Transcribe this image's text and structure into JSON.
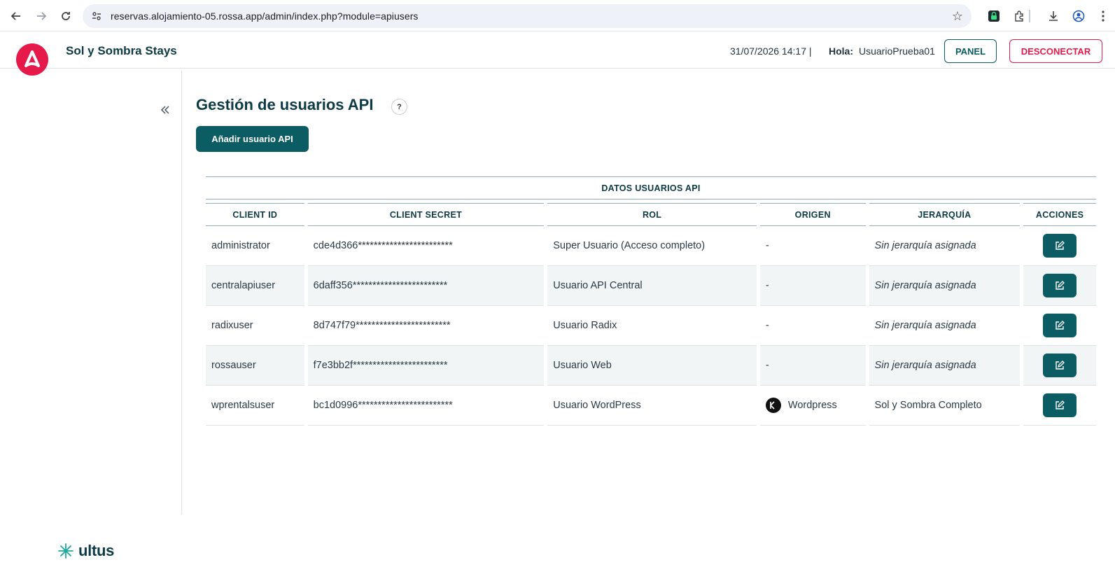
{
  "browser": {
    "url": "reservas.alojamiento-05.rossa.app/admin/index.php?module=apiusers"
  },
  "header": {
    "brand": "Sol y Sombra Stays",
    "datetime": "31/07/2026 14:17 |",
    "hola_label": "Hola:",
    "username": "UsuarioPrueba01",
    "panel_label": "PANEL",
    "logout_label": "DESCONECTAR",
    "accent_color": "#e5194a",
    "primary_color": "#0b5c63"
  },
  "main": {
    "title": "Gestión de usuarios API",
    "help_label": "?",
    "add_button": "Añadir usuario API",
    "table": {
      "caption": "DATOS USUARIOS API",
      "columns": [
        "CLIENT ID",
        "CLIENT SECRET",
        "ROL",
        "ORIGEN",
        "JERARQUÍA",
        "ACCIONES"
      ],
      "rows": [
        {
          "client_id": "administrator",
          "secret": "cde4d366************************",
          "rol": "Super Usuario (Acceso completo)",
          "origen": "-",
          "jerarquia": "Sin jerarquía asignada"
        },
        {
          "client_id": "centralapiuser",
          "secret": "6daff356************************",
          "rol": "Usuario API Central",
          "origen": "-",
          "jerarquia": "Sin jerarquía asignada"
        },
        {
          "client_id": "radixuser",
          "secret": "8d747f79************************",
          "rol": "Usuario Radix",
          "origen": "-",
          "jerarquia": "Sin jerarquía asignada"
        },
        {
          "client_id": "rossauser",
          "secret": "f7e3bb2f************************",
          "rol": "Usuario Web",
          "origen": "-",
          "jerarquia": "Sin jerarquía asignada"
        },
        {
          "client_id": "wprentalsuser",
          "secret": "bc1d0996************************",
          "rol": "Usuario WordPress",
          "origen": "Wordpress",
          "jerarquia": "Sol y Sombra Completo"
        }
      ]
    }
  },
  "footer": {
    "logo_text": "ultus"
  }
}
